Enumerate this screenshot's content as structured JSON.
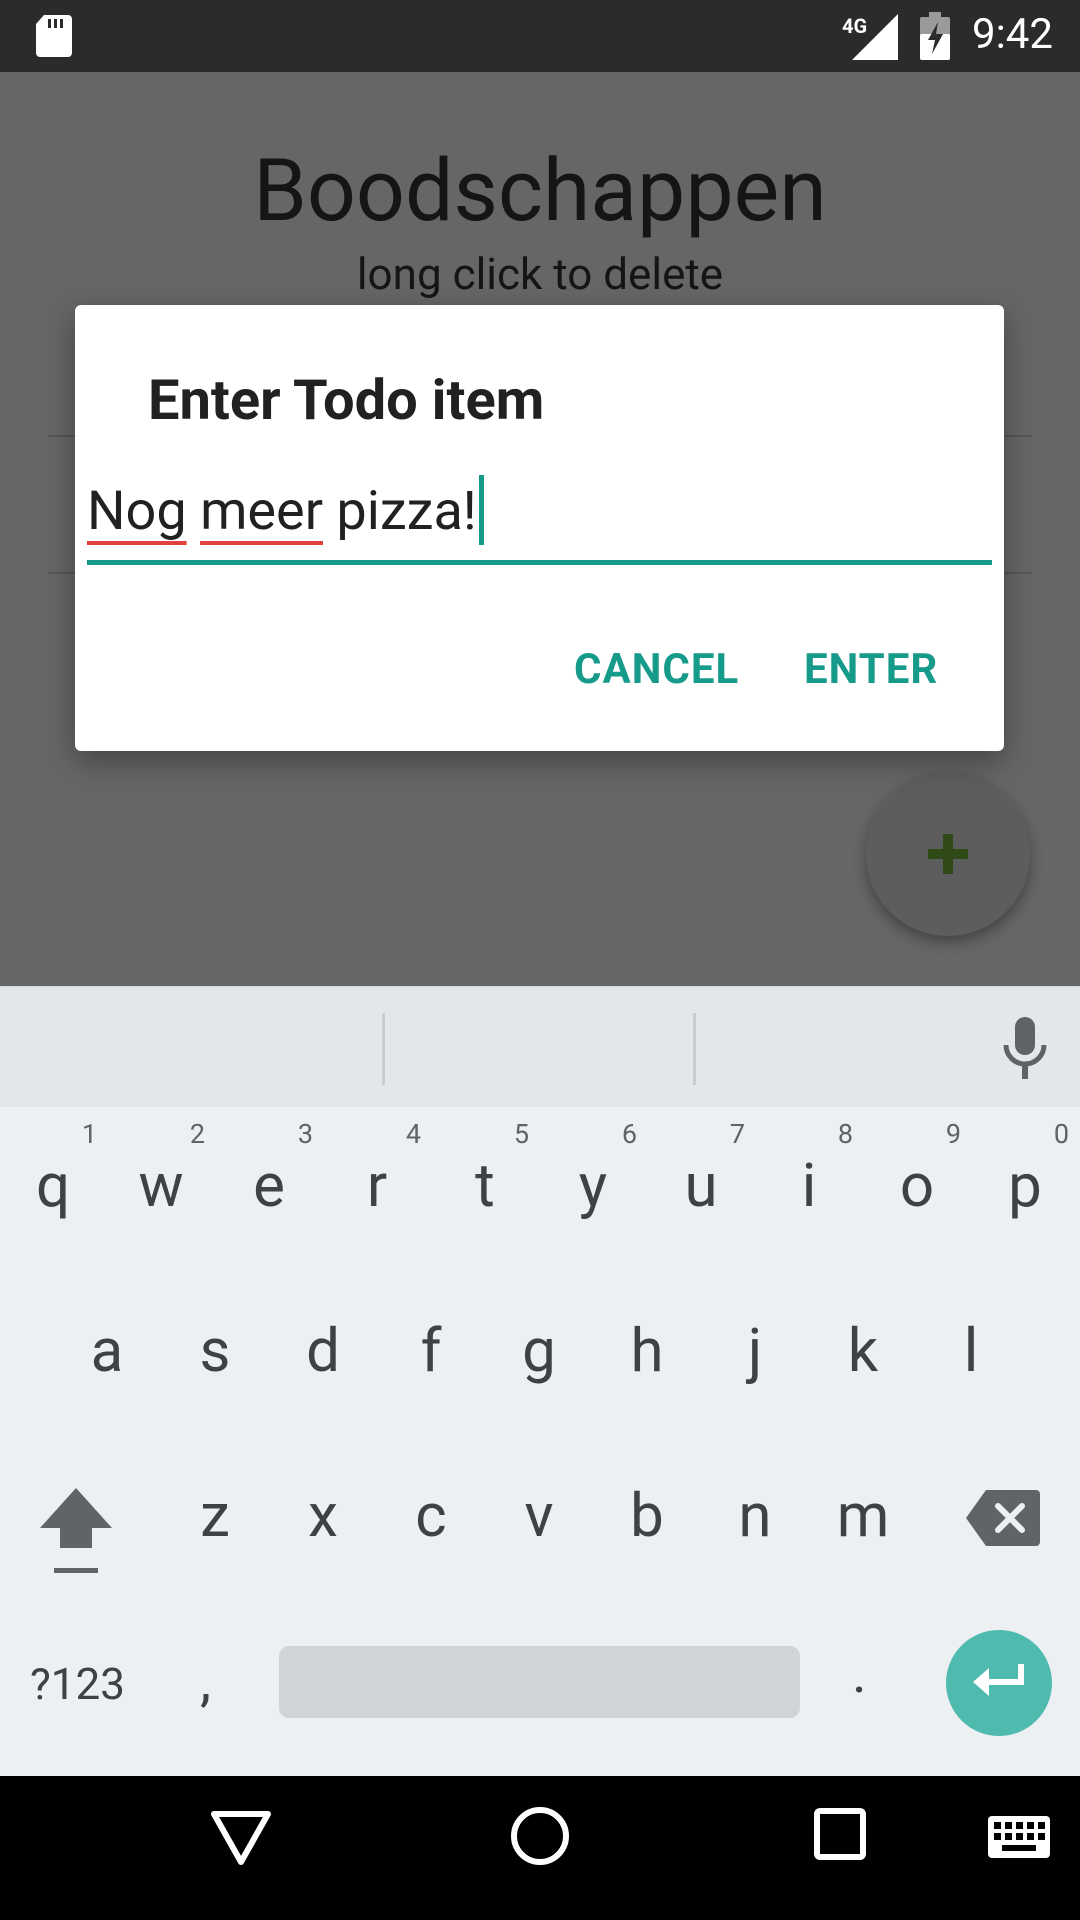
{
  "status_bar": {
    "network": "4G",
    "time": "9:42",
    "icons": [
      "sd-card-icon",
      "signal-icon",
      "battery-charging-icon"
    ]
  },
  "app": {
    "title": "Boodschappen",
    "subtitle": "long click to delete",
    "fab_icon": "plus-icon"
  },
  "dialog": {
    "title": "Enter Todo item",
    "input_words": [
      "Nog",
      "meer",
      "pizza!"
    ],
    "cancel_label": "CANCEL",
    "enter_label": "ENTER",
    "accent_color": "#169a8a"
  },
  "keyboard": {
    "suggestions": [
      "",
      "",
      ""
    ],
    "row1": [
      {
        "ch": "q",
        "hint": "1"
      },
      {
        "ch": "w",
        "hint": "2"
      },
      {
        "ch": "e",
        "hint": "3"
      },
      {
        "ch": "r",
        "hint": "4"
      },
      {
        "ch": "t",
        "hint": "5"
      },
      {
        "ch": "y",
        "hint": "6"
      },
      {
        "ch": "u",
        "hint": "7"
      },
      {
        "ch": "i",
        "hint": "8"
      },
      {
        "ch": "o",
        "hint": "9"
      },
      {
        "ch": "p",
        "hint": "0"
      }
    ],
    "row2": [
      "a",
      "s",
      "d",
      "f",
      "g",
      "h",
      "j",
      "k",
      "l"
    ],
    "row3": [
      "z",
      "x",
      "c",
      "v",
      "b",
      "n",
      "m"
    ],
    "symbols_label": "?123",
    "comma": ",",
    "period": ".",
    "enter_color": "#4fbaae"
  },
  "nav_bar": {
    "items": [
      "back-icon",
      "home-icon",
      "recents-icon",
      "keyboard-switch-icon"
    ]
  }
}
